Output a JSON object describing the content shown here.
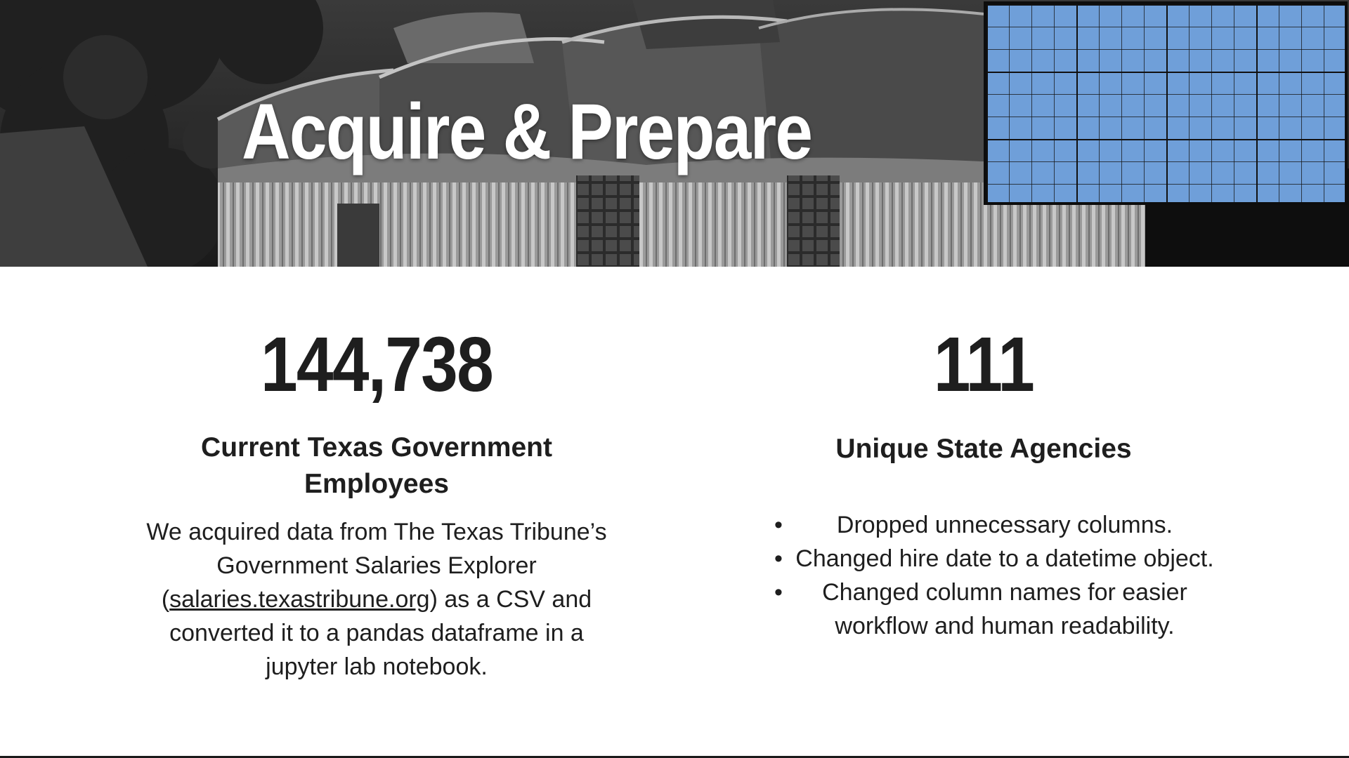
{
  "header": {
    "title": "Acquire & Prepare"
  },
  "stats": {
    "left": {
      "number": "144,738",
      "label": "Current Texas Government Employees",
      "description_before": "We acquired data from The Texas Tribune’s Government Salaries Explorer (",
      "link_text": "salaries.texastribune.org",
      "description_after": ") as a CSV and converted it to a pandas dataframe in a jupyter lab notebook."
    },
    "right": {
      "number": "111",
      "label": "Unique State Agencies",
      "bullets": [
        "Dropped unnecessary columns.",
        "Changed hire date to a datetime object.",
        "Changed column names for easier workflow and human readability."
      ]
    }
  },
  "colors": {
    "grid_fill": "#6f9fd9",
    "text": "#1e1e1e",
    "banner_bg": "#151515"
  }
}
